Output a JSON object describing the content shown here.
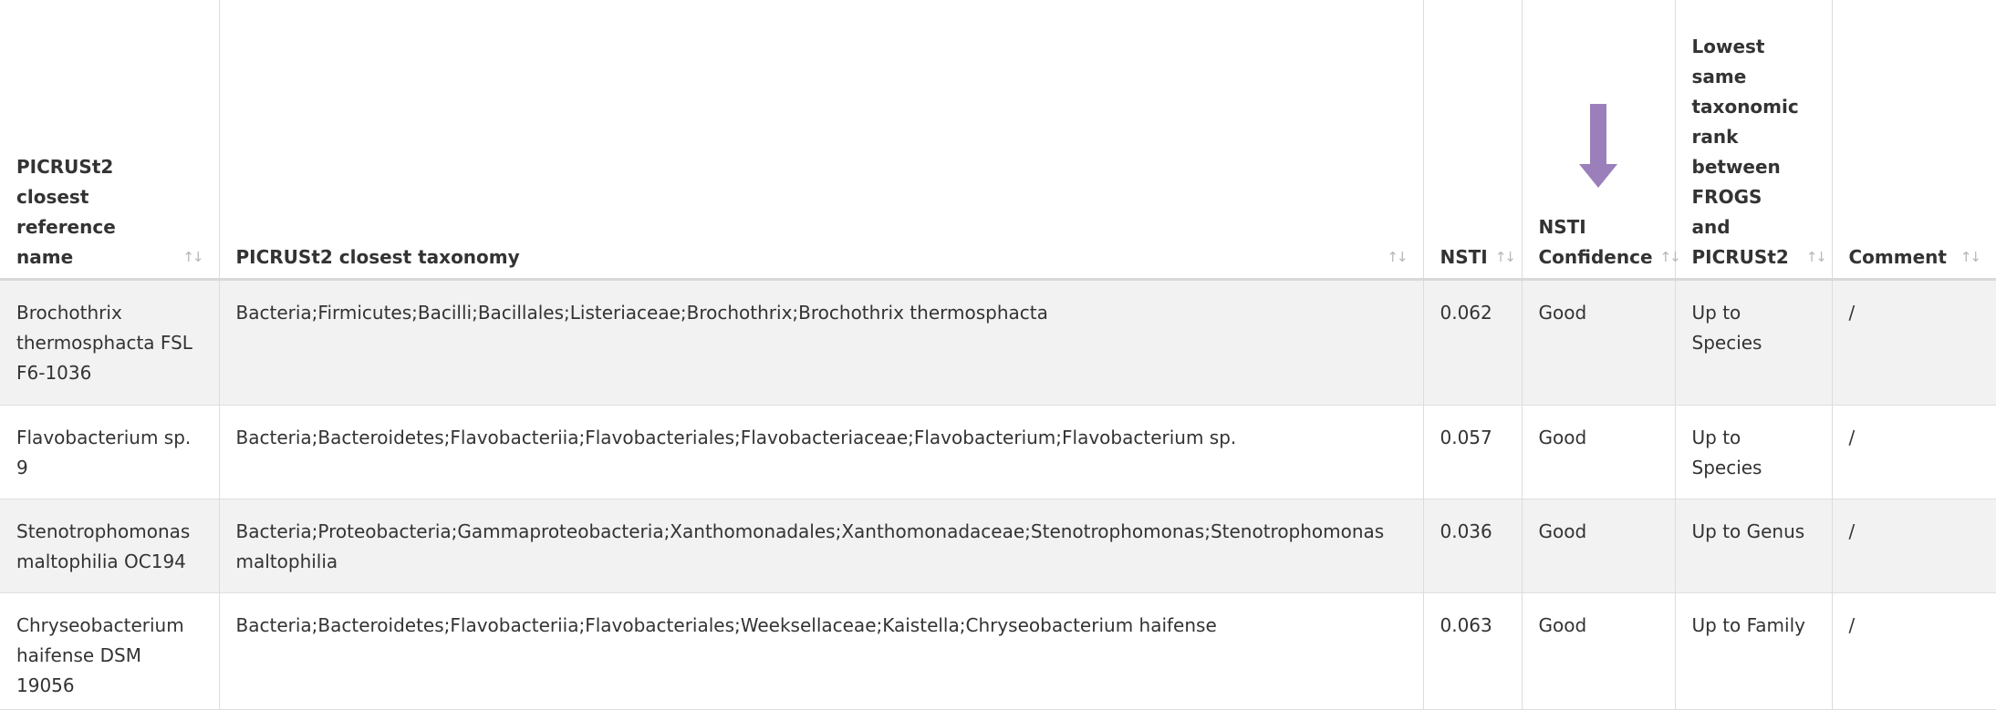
{
  "table": {
    "headers": [
      {
        "label": "PICRUSt2 closest reference name",
        "sort": "↑↓"
      },
      {
        "label": "PICRUSt2 closest taxonomy",
        "sort": "↑↓"
      },
      {
        "label": "NSTI",
        "sort": "↑↓"
      },
      {
        "label": "NSTI Confidence",
        "sort": "↑↓"
      },
      {
        "label": "Lowest same taxonomic rank between FROGS and PICRUSt2",
        "sort": "↑↓"
      },
      {
        "label": "Comment",
        "sort": "↑↓"
      }
    ],
    "rows": [
      [
        "Brochothrix thermosphacta FSL F6-1036",
        "Bacteria;Firmicutes;Bacilli;Bacillales;Listeriaceae;Brochothrix;Brochothrix thermosphacta",
        "0.062",
        "Good",
        "Up to Species",
        "/"
      ],
      [
        "Flavobacterium sp. 9",
        "Bacteria;Bacteroidetes;Flavobacteriia;Flavobacteriales;Flavobacteriaceae;Flavobacterium;Flavobacterium sp.",
        "0.057",
        "Good",
        "Up to Species",
        "/"
      ],
      [
        "Stenotrophomonas maltophilia OC194",
        "Bacteria;Proteobacteria;Gammaproteobacteria;Xanthomonadales;Xanthomonadaceae;Stenotrophomonas;Stenotrophomonas maltophilia",
        "0.036",
        "Good",
        "Up to Genus",
        "/"
      ],
      [
        "Chryseobacterium haifense DSM 19056",
        "Bacteria;Bacteroidetes;Flavobacteriia;Flavobacteriales;Weeksellaceae;Kaistella;Chryseobacterium haifense",
        "0.063",
        "Good",
        "Up to Family",
        "/"
      ]
    ]
  },
  "annotation": {
    "arrow_color": "#9b7fba",
    "arrow_icon": "down-arrow-icon"
  }
}
